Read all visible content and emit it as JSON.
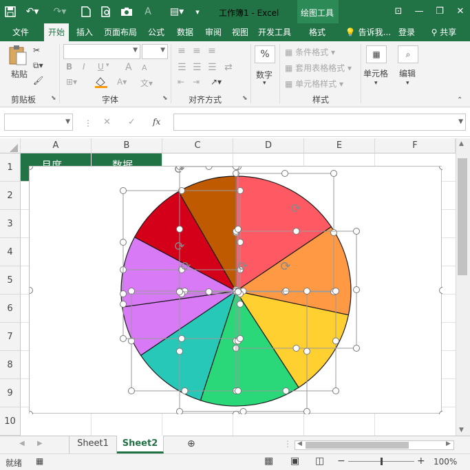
{
  "window": {
    "title": "工作簿1 - Excel",
    "context_tools": "绘图工具",
    "tell_me": "告诉我...",
    "login": "登录",
    "share": "共享"
  },
  "tabs": [
    "文件",
    "开始",
    "插入",
    "页面布局",
    "公式",
    "数据",
    "审阅",
    "视图",
    "开发工具",
    "格式"
  ],
  "active_tab": "开始",
  "ribbon": {
    "clipboard": {
      "label": "剪贴板",
      "paste": "粘贴"
    },
    "font": {
      "label": "字体",
      "bold": "B",
      "italic": "I",
      "underline": "U",
      "size_up": "A",
      "size_down": "A"
    },
    "alignment": {
      "label": "对齐方式"
    },
    "number": {
      "label": "数字",
      "percent": "%"
    },
    "styles": {
      "label": "样式",
      "conditional": "条件格式",
      "table": "套用表格格式",
      "cell_styles": "单元格样式"
    },
    "cells": {
      "label": "单元格"
    },
    "editing": {
      "label": "编辑"
    }
  },
  "formula_bar": {
    "fx": "fx",
    "cancel": "✕",
    "enter": "✓"
  },
  "columns": [
    "A",
    "B",
    "C",
    "D",
    "E",
    "F"
  ],
  "rows": [
    "1",
    "2",
    "3",
    "4",
    "5",
    "6",
    "7",
    "8",
    "9",
    "10"
  ],
  "cells": {
    "A1": "月度",
    "B1": "数据"
  },
  "sheets": [
    "Sheet1",
    "Sheet2"
  ],
  "active_sheet": "Sheet2",
  "status": {
    "ready": "就绪",
    "zoom": "100%",
    "zoom_level": 1.0
  },
  "pie_colors": [
    "#ff5a64",
    "#ff9944",
    "#ffd030",
    "#2ad87a",
    "#28c8b8",
    "#d87af5",
    "#d4001a",
    "#bf5a00"
  ],
  "colors": {
    "accent": "#217346",
    "ribbon_bg": "#f3f3f3"
  }
}
